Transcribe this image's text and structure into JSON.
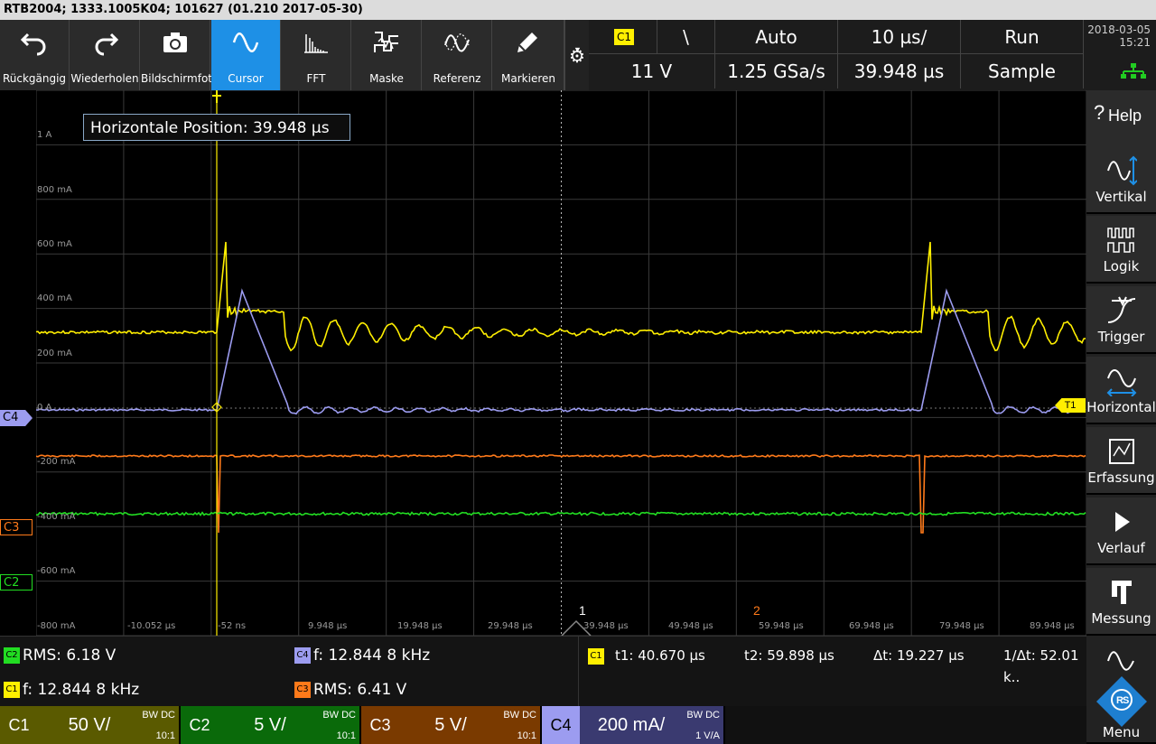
{
  "title": "RTB2004; 1333.1005K04; 101627 (01.210 2017-05-30)",
  "toolbar": [
    {
      "label": "Rückgängig",
      "icon": "undo-icon"
    },
    {
      "label": "Wiederholen",
      "icon": "redo-icon"
    },
    {
      "label": "Bildschirmfoto",
      "icon": "camera-icon"
    },
    {
      "label": "Cursor",
      "icon": "cursor-wave-icon",
      "active": true
    },
    {
      "label": "FFT",
      "icon": "fft-icon"
    },
    {
      "label": "Maske",
      "icon": "mask-icon"
    },
    {
      "label": "Referenz",
      "icon": "reference-icon"
    },
    {
      "label": "Markieren",
      "icon": "pencil-icon"
    }
  ],
  "acquisition": {
    "trigger_source": "C1",
    "trigger_slope": "\\",
    "trigger_mode": "Auto",
    "timebase": "10 µs/",
    "run_state": "Run",
    "trigger_level": "11 V",
    "sample_rate": "1.25 GSa/s",
    "horizontal_position": "39.948 µs",
    "acq_mode": "Sample"
  },
  "datetime": {
    "date": "2018-03-05",
    "time": "15:21"
  },
  "sidebar": [
    {
      "label": "Help",
      "icon": "help-icon"
    },
    {
      "label": "Vertikal",
      "icon": "vertical-icon"
    },
    {
      "label": "Logik",
      "icon": "logic-icon"
    },
    {
      "label": "Trigger",
      "icon": "trigger-icon"
    },
    {
      "label": "Horizontal",
      "icon": "horizontal-icon"
    },
    {
      "label": "Erfassung",
      "icon": "acquisition-icon"
    },
    {
      "label": "Verlauf",
      "icon": "play-icon"
    },
    {
      "label": "Messung",
      "icon": "caliper-icon"
    },
    {
      "label": "Menu",
      "icon": "rs-logo-icon"
    }
  ],
  "cursor_info": "Horizontale Position: 39.948 µs",
  "y_labels": [
    "1 A",
    "800 mA",
    "600 mA",
    "400 mA",
    "200 mA",
    "0 A",
    "-200 mA",
    "-400 mA",
    "-600 mA",
    "-800 mA"
  ],
  "x_labels": [
    "-10.052 µs",
    "-52 ns",
    "9.948 µs",
    "19.948 µs",
    "29.948 µs",
    "39.948 µs",
    "49.948 µs",
    "59.948 µs",
    "69.948 µs",
    "79.948 µs",
    "89.948 µs"
  ],
  "channel_markers": {
    "c4": "C4",
    "c3": "C3",
    "c2": "C2",
    "trigger": "T1",
    "cursor1": "1",
    "cursor2": "2"
  },
  "measurements": {
    "c2_rms": {
      "badge": "C2",
      "text": "RMS: 6.18 V"
    },
    "c4_freq": {
      "badge": "C4",
      "text": "f: 12.844 8 kHz"
    },
    "c1_freq": {
      "badge": "C1",
      "text": "f: 12.844 8 kHz"
    },
    "c3_rms": {
      "badge": "C3",
      "text": "RMS: 6.41 V"
    },
    "cursor_badge": "C1",
    "t1": "t1: 40.670 µs",
    "t2": "t2: 59.898 µs",
    "dt": "Δt: 19.227 µs",
    "inv_dt": "1/Δt: 52.01 k.."
  },
  "channels": [
    {
      "name": "C1",
      "scale": "50 V/",
      "bw": "BW DC",
      "att": "10:1",
      "color": "#5a5a00"
    },
    {
      "name": "C2",
      "scale": "5 V/",
      "bw": "BW DC",
      "att": "10:1",
      "color": "#0a6a0a"
    },
    {
      "name": "C3",
      "scale": "5 V/",
      "bw": "BW DC",
      "att": "10:1",
      "color": "#7a3a00"
    },
    {
      "name": "C4",
      "scale": "200 mA/",
      "bw": "BW DC",
      "att": "1 V/A",
      "color": "#8080ff"
    }
  ],
  "colors": {
    "c1": "#ffef00",
    "c2": "#22dd22",
    "c3": "#ff7a1a",
    "c4": "#9c9cf0",
    "accent": "#1e90e6"
  }
}
